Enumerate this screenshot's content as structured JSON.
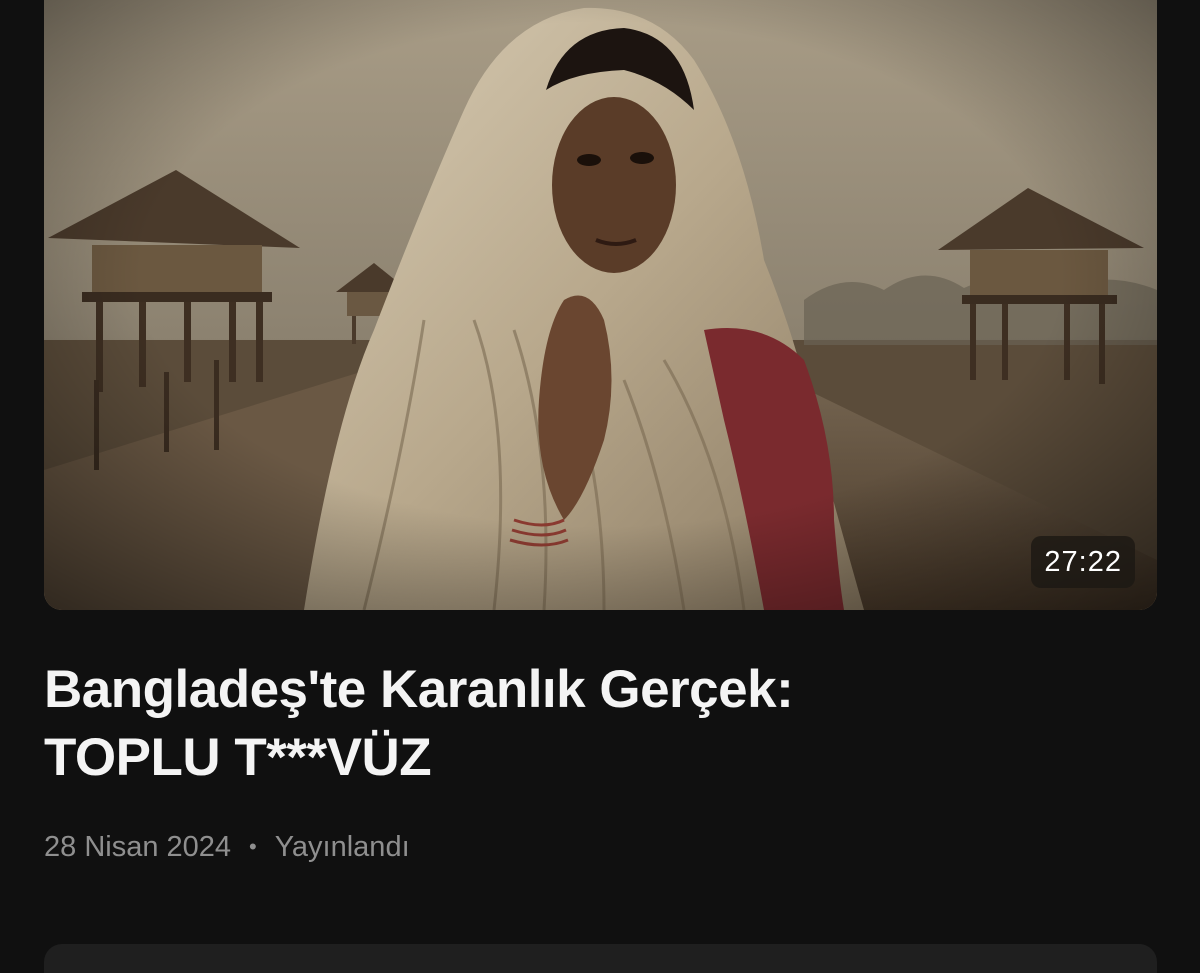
{
  "video": {
    "thumbnail_description_icon": "video-thumbnail",
    "duration": "27:22",
    "title_line1": "Bangladeş'te Karanlık Gerçek:",
    "title_line2": "TOPLU T***VÜZ",
    "date": "28 Nisan 2024",
    "separator": "•",
    "status": "Yayınlandı"
  },
  "colors": {
    "background": "#101010",
    "title": "#f4f4f4",
    "meta": "#8f8f8f",
    "card": "#1f1f1f"
  }
}
